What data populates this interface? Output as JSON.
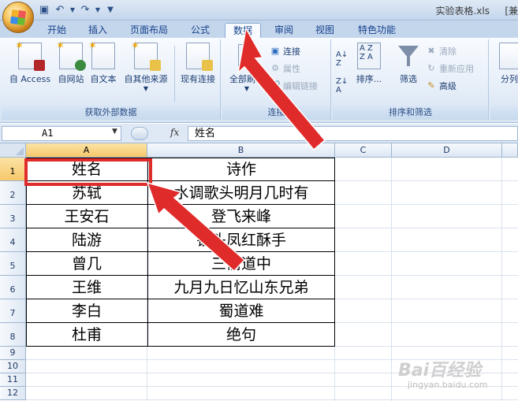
{
  "window": {
    "doc_title": "实验表格.xls",
    "app_title": "[兼"
  },
  "qat": [
    "save-icon",
    "undo-icon",
    "redo-icon",
    "customize-icon"
  ],
  "tabs": [
    {
      "label": "开始"
    },
    {
      "label": "插入"
    },
    {
      "label": "页面布局"
    },
    {
      "label": "公式"
    },
    {
      "label": "数据",
      "active": true
    },
    {
      "label": "审阅"
    },
    {
      "label": "视图"
    },
    {
      "label": "特色功能"
    }
  ],
  "ribbon": {
    "external_group": {
      "label": "获取外部数据",
      "buttons": [
        "自 Access",
        "自网站",
        "自文本",
        "自其他来源",
        "现有连接"
      ]
    },
    "connections_group": {
      "label": "连接",
      "refresh": "全部刷新",
      "connect": "连接",
      "properties": "属性",
      "edit_links": "编辑链接"
    },
    "sort_group": {
      "label": "排序和筛选",
      "sort": "排序...",
      "filter": "筛选",
      "clear": "清除",
      "reapply": "重新应用",
      "advanced": "高级"
    },
    "data_tools_group": {
      "split": "分列"
    }
  },
  "formula_bar": {
    "name_box": "A1",
    "fx": "fx",
    "value": "姓名"
  },
  "sheet": {
    "columns": [
      "A",
      "B",
      "C",
      "D"
    ],
    "rows": [
      "1",
      "2",
      "3",
      "4",
      "5",
      "6",
      "7",
      "8",
      "9",
      "10",
      "11",
      "12"
    ],
    "cells": [
      [
        "姓名",
        "诗作"
      ],
      [
        "苏轼",
        "水调歌头明月几时有"
      ],
      [
        "王安石",
        "登飞来峰"
      ],
      [
        "陆游",
        "钗头凤红酥手"
      ],
      [
        "曾几",
        "三衢道中"
      ],
      [
        "王维",
        "九月九日忆山东兄弟"
      ],
      [
        "李白",
        "蜀道难"
      ],
      [
        "杜甫",
        "绝句"
      ]
    ]
  },
  "watermark": {
    "main": "Bai百经验",
    "sub": "jingyan.baidu.com"
  },
  "annotation_color": "#e02b2b"
}
